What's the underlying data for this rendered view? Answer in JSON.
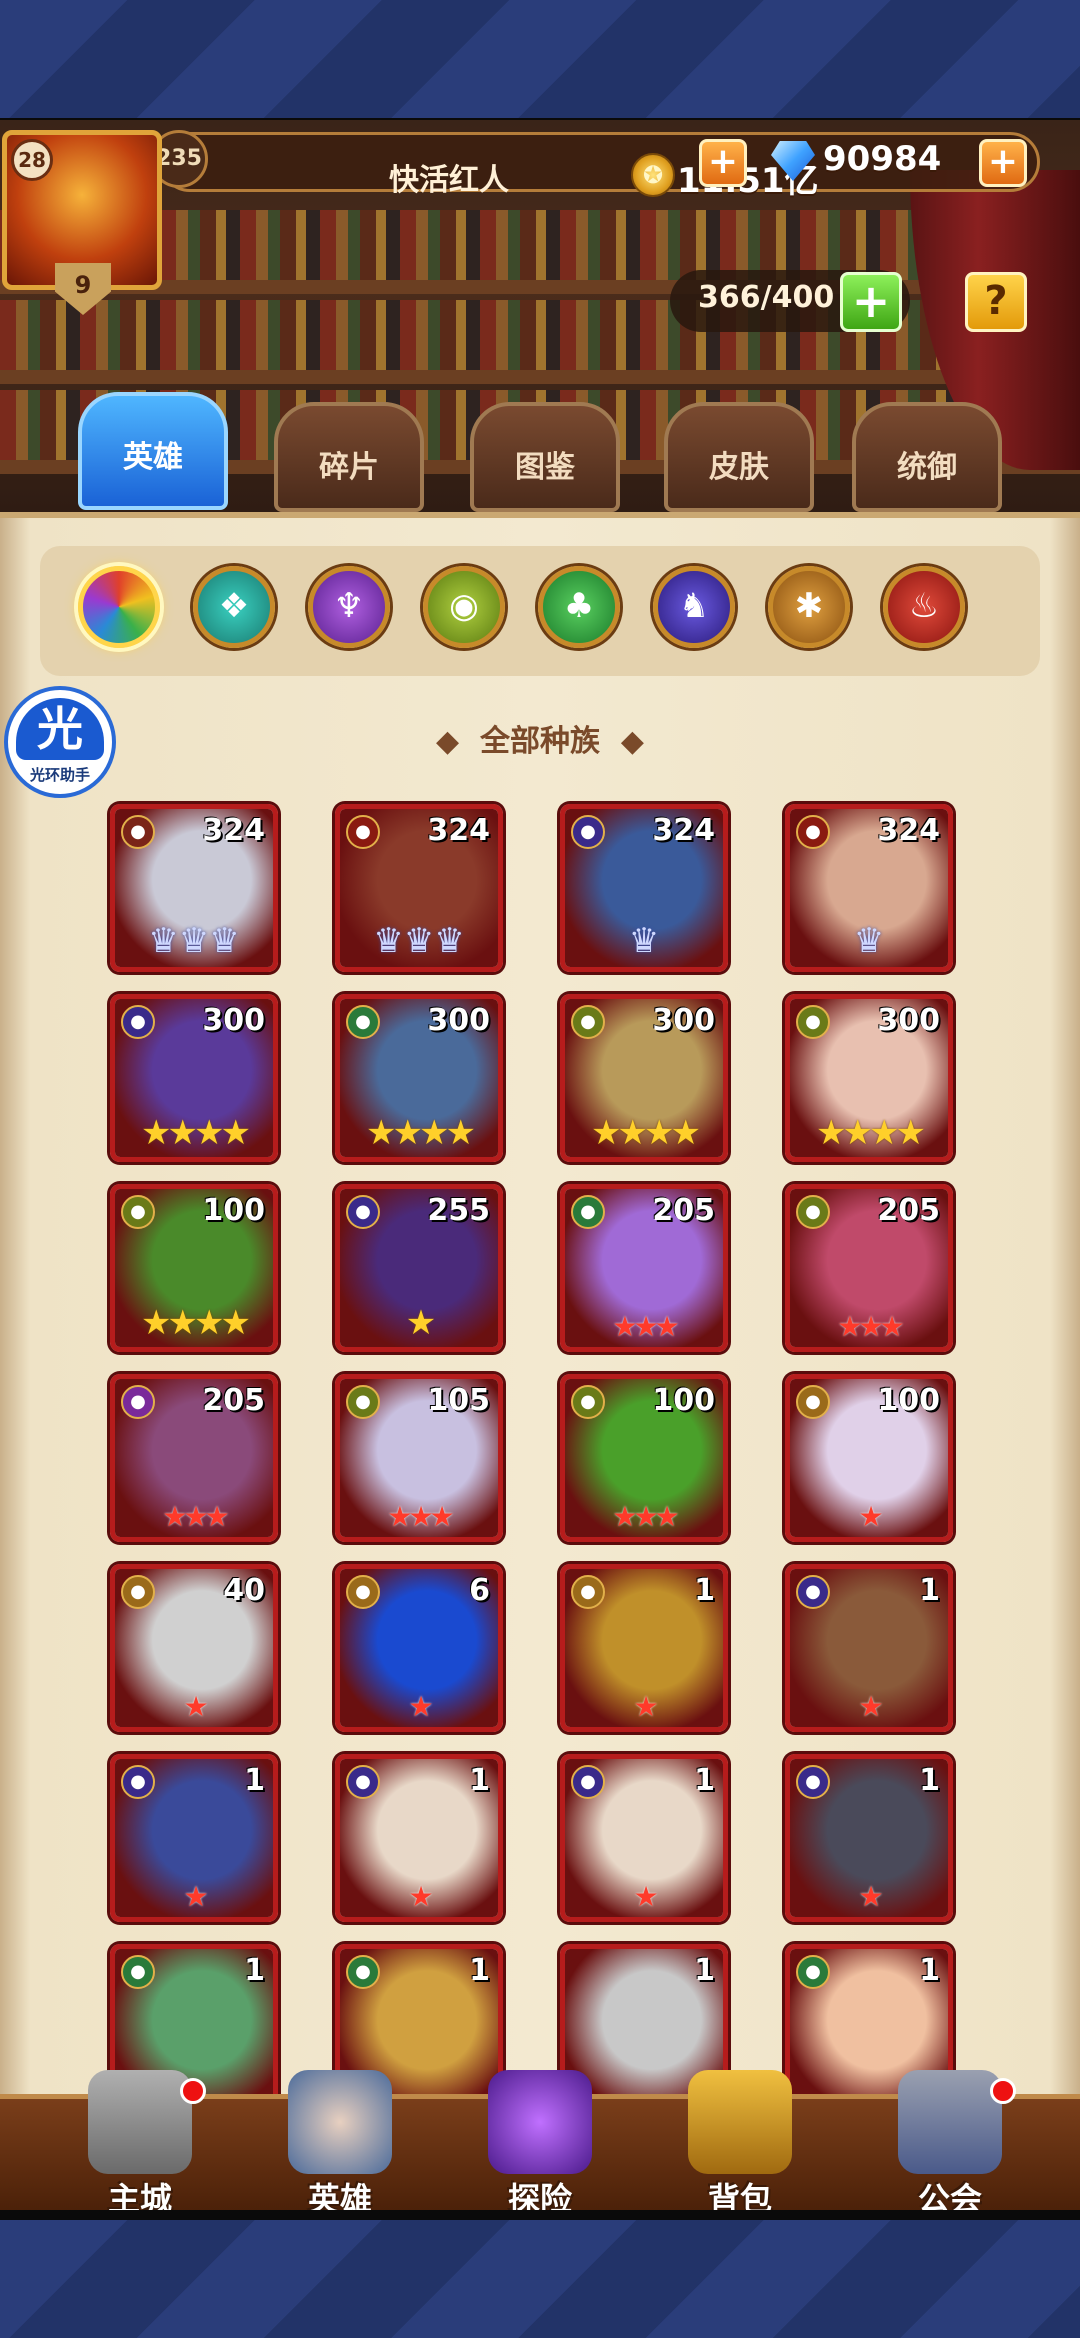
{
  "player": {
    "level": "235",
    "name": "快活红人",
    "vip": "28",
    "rank": "9"
  },
  "currency": {
    "gold": "11.51亿",
    "gems": "90984"
  },
  "capacity": "366/400",
  "tabs": [
    "英雄",
    "碎片",
    "图鉴",
    "皮肤",
    "统御"
  ],
  "active_tab": "英雄",
  "race_filter_label": "全部种族",
  "helper_label": "光环助手",
  "helper_glyph": "光",
  "icons": {
    "plus": "+",
    "help": "?"
  },
  "heroes": [
    {
      "level": "324",
      "race": "forest-dark",
      "mark": "crown",
      "count": 3
    },
    {
      "level": "324",
      "race": "fire",
      "mark": "crown",
      "count": 3
    },
    {
      "level": "324",
      "race": "shadow",
      "mark": "crown",
      "count": 1
    },
    {
      "level": "324",
      "race": "fire",
      "mark": "crown",
      "count": 1
    },
    {
      "level": "300",
      "race": "shadow",
      "mark": "gold-star",
      "count": 4
    },
    {
      "level": "300",
      "race": "nature",
      "mark": "gold-star",
      "count": 4
    },
    {
      "level": "300",
      "race": "nature-eye",
      "mark": "gold-star",
      "count": 4
    },
    {
      "level": "300",
      "race": "nature-eye",
      "mark": "gold-star",
      "count": 4
    },
    {
      "level": "100",
      "race": "nature-eye",
      "mark": "gold-star",
      "count": 4
    },
    {
      "level": "255",
      "race": "shadow",
      "mark": "gold-star",
      "count": 1
    },
    {
      "level": "205",
      "race": "nature",
      "mark": "red-star",
      "count": 3
    },
    {
      "level": "205",
      "race": "nature-eye",
      "mark": "red-star",
      "count": 3
    },
    {
      "level": "205",
      "race": "abyss",
      "mark": "red-star",
      "count": 3
    },
    {
      "level": "105",
      "race": "nature-eye",
      "mark": "red-star",
      "count": 3
    },
    {
      "level": "100",
      "race": "nature-eye",
      "mark": "red-star",
      "count": 3
    },
    {
      "level": "100",
      "race": "light",
      "mark": "red-star",
      "count": 1
    },
    {
      "level": "40",
      "race": "light",
      "mark": "red-star",
      "count": 1
    },
    {
      "level": "6",
      "race": "light",
      "mark": "red-star",
      "count": 1
    },
    {
      "level": "1",
      "race": "light",
      "mark": "red-star",
      "count": 1
    },
    {
      "level": "1",
      "race": "shadow",
      "mark": "red-star",
      "count": 1
    },
    {
      "level": "1",
      "race": "shadow",
      "mark": "red-star",
      "count": 1
    },
    {
      "level": "1",
      "race": "shadow",
      "mark": "red-star",
      "count": 1
    },
    {
      "level": "1",
      "race": "shadow",
      "mark": "red-star",
      "count": 1
    },
    {
      "level": "1",
      "race": "shadow",
      "mark": "red-star",
      "count": 1
    },
    {
      "level": "1",
      "race": "nature",
      "mark": "none",
      "count": 0
    },
    {
      "level": "1",
      "race": "nature",
      "mark": "none",
      "count": 0
    },
    {
      "level": "1",
      "race": "none",
      "mark": "none",
      "count": 0
    },
    {
      "level": "1",
      "race": "nature",
      "mark": "none",
      "count": 0
    }
  ],
  "nav": [
    {
      "label": "主城",
      "badge": true
    },
    {
      "label": "英雄",
      "badge": false
    },
    {
      "label": "探险",
      "badge": false
    },
    {
      "label": "背包",
      "badge": false
    },
    {
      "label": "公会",
      "badge": true
    }
  ],
  "colors": {
    "accent": "#1a62d6",
    "card_border": "#b61c1c",
    "gold_star": "#ffd02a",
    "red_star": "#ff3a2a"
  }
}
